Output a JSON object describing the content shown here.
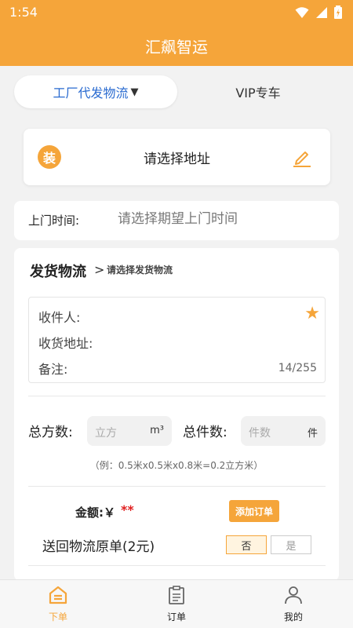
{
  "status_bar": {
    "time": "1:54"
  },
  "app_bar": {
    "title": "汇飙智运"
  },
  "mode_tabs": {
    "active_label": "工厂代发物流",
    "active_caret": "▼",
    "inactive_label": "VIP专车"
  },
  "address_card": {
    "icon_text": "装",
    "placeholder": "请选择地址",
    "icon_names": [
      "zhuang-badge-icon",
      "edit-pencil-icon"
    ]
  },
  "pickup": {
    "label": "上门时间:",
    "placeholder": "请选择期望上门时间"
  },
  "logistics": {
    "title": "发货物流",
    "chevron": ">",
    "select_text": "请选择发货物流",
    "receiver_label": "收件人:",
    "address_label": "收货地址:",
    "note_label": "备注:",
    "note_counter": "14/255",
    "star_icon": "star-icon"
  },
  "metrics": {
    "volume_label": "总方数:",
    "volume_placeholder": "立方",
    "volume_unit": "m³",
    "count_label": "总件数:",
    "count_placeholder": "件数",
    "count_unit": "件",
    "hint": "（例：0.5米x0.5米x0.8米=0.2立方米）"
  },
  "amount": {
    "label": "金额:￥",
    "value": "**",
    "add_order_button": "添加订单"
  },
  "return_slip": {
    "label": "送回物流原单(2元)",
    "option_selected": "否",
    "option_other": "是"
  },
  "bottom_nav": {
    "items": [
      {
        "label": "下单",
        "icon": "home-icon",
        "active": true
      },
      {
        "label": "订单",
        "icon": "clipboard-icon",
        "active": false
      },
      {
        "label": "我的",
        "icon": "user-icon",
        "active": false
      }
    ]
  },
  "colors": {
    "accent": "#f5a53a",
    "tab_active_text": "#2a6bd0",
    "amount_red": "#e02020"
  }
}
